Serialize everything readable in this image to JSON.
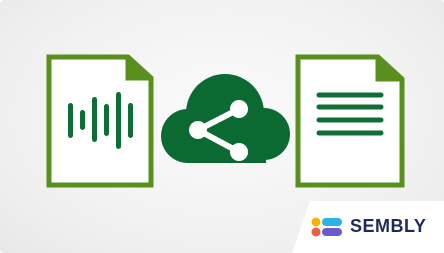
{
  "brand": {
    "name": "SEMBLY",
    "logo_colors": [
      "#f5b400",
      "#f25c3c",
      "#2bb3e8",
      "#6a5acd"
    ]
  },
  "colors": {
    "green_outline": "#5a8f1e",
    "cloud_green": "#0a6a32",
    "stripe_green": "#0f6d36",
    "background": "#f2f2f2"
  },
  "icons": [
    "audio-file-icon",
    "cloud-share-icon",
    "text-document-icon"
  ]
}
